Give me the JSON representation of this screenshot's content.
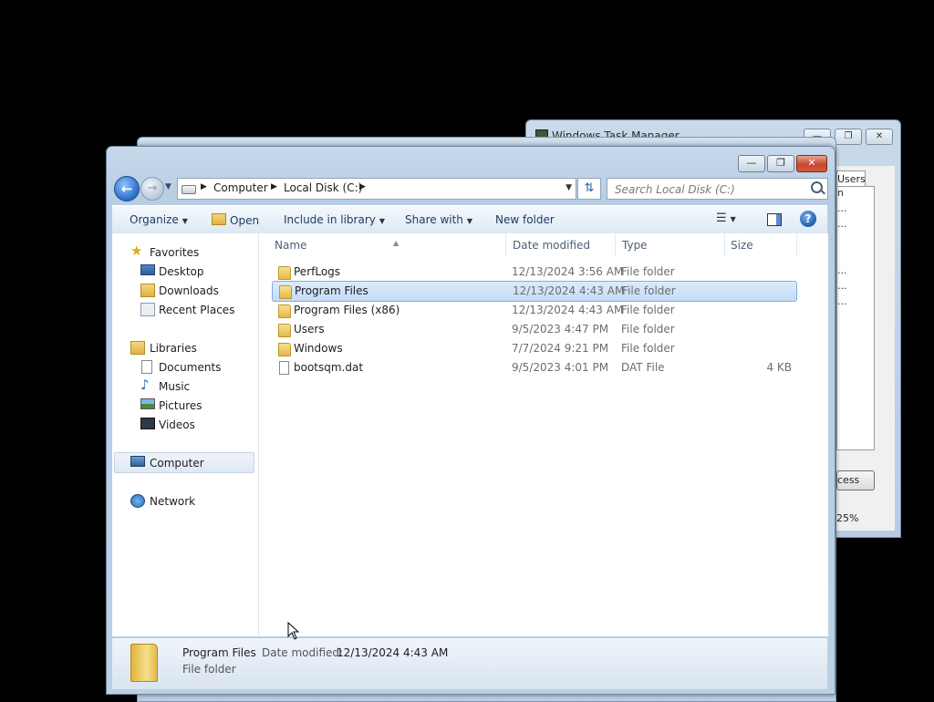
{
  "task_manager": {
    "title": "Windows Task Manager",
    "tab_users": "Users",
    "partial_rows": [
      "n",
      "...",
      "...",
      "...",
      "...",
      "..."
    ],
    "process_button": "cess",
    "status_cpu": "25%",
    "buttons": {
      "minimize": "—",
      "restore": "❐",
      "close": "✕"
    }
  },
  "explorer": {
    "window_buttons": {
      "minimize": "—",
      "restore": "❐",
      "close": "✕"
    },
    "address": {
      "crumbs": [
        "Computer",
        "Local Disk (C:)"
      ]
    },
    "search": {
      "placeholder": "Search Local Disk (C:)"
    },
    "toolbar": {
      "organize": "Organize",
      "open": "Open",
      "include_in_library": "Include in library",
      "share_with": "Share with",
      "new_folder": "New folder",
      "help": "?"
    },
    "nav": {
      "favorites": "Favorites",
      "desktop": "Desktop",
      "downloads": "Downloads",
      "recent_places": "Recent Places",
      "libraries": "Libraries",
      "documents": "Documents",
      "music": "Music",
      "pictures": "Pictures",
      "videos": "Videos",
      "computer": "Computer",
      "network": "Network"
    },
    "columns": {
      "name": "Name",
      "date_modified": "Date modified",
      "type": "Type",
      "size": "Size"
    },
    "files": [
      {
        "name": "PerfLogs",
        "date": "12/13/2024 3:56 AM",
        "type": "File folder",
        "size": ""
      },
      {
        "name": "Program Files",
        "date": "12/13/2024 4:43 AM",
        "type": "File folder",
        "size": ""
      },
      {
        "name": "Program Files (x86)",
        "date": "12/13/2024 4:43 AM",
        "type": "File folder",
        "size": ""
      },
      {
        "name": "Users",
        "date": "9/5/2023 4:47 PM",
        "type": "File folder",
        "size": ""
      },
      {
        "name": "Windows",
        "date": "7/7/2024 9:21 PM",
        "type": "File folder",
        "size": ""
      },
      {
        "name": "bootsqm.dat",
        "date": "9/5/2023 4:01 PM",
        "type": "DAT File",
        "size": "4 KB"
      }
    ],
    "details": {
      "name": "Program Files",
      "date_label": "Date modified:",
      "date": "12/13/2024 4:43 AM",
      "type": "File folder"
    }
  }
}
